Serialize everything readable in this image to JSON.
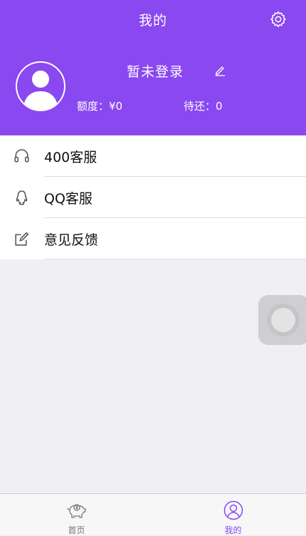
{
  "header": {
    "title": "我的",
    "username": "暂未登录",
    "quota": "额度：¥0",
    "owed": "待还：0",
    "accent_color": "#8a48f0"
  },
  "menu": {
    "items": [
      {
        "label": "400客服",
        "icon": "headset-icon"
      },
      {
        "label": "QQ客服",
        "icon": "qq-penguin-icon"
      },
      {
        "label": "意见反馈",
        "icon": "feedback-edit-icon"
      }
    ]
  },
  "tabbar": {
    "tabs": [
      {
        "label": "首页",
        "icon": "piggy-bank-icon",
        "active": false
      },
      {
        "label": "我的",
        "icon": "user-circle-icon",
        "active": true
      }
    ]
  }
}
